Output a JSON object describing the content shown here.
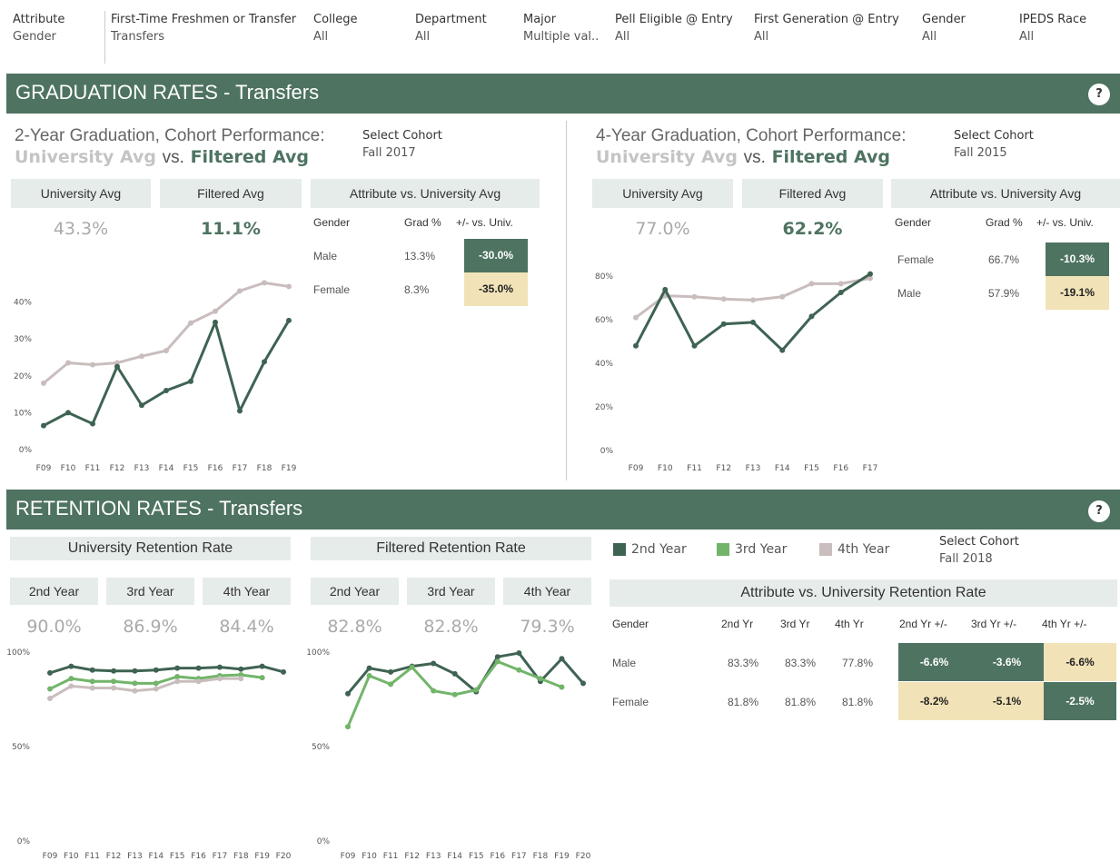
{
  "filters": [
    {
      "label": "Attribute",
      "value": "Gender"
    },
    {
      "label": "First-Time Freshmen or Transfer",
      "value": "Transfers"
    },
    {
      "label": "College",
      "value": "All"
    },
    {
      "label": "Department",
      "value": "All"
    },
    {
      "label": "Major",
      "value": "Multiple val.."
    },
    {
      "label": "Pell Eligible @ Entry",
      "value": "All"
    },
    {
      "label": "First Generation @ Entry",
      "value": "All"
    },
    {
      "label": "Gender",
      "value": "All"
    },
    {
      "label": "IPEDS Race",
      "value": "All"
    }
  ],
  "colors": {
    "accent": "#4e7361",
    "university_line": "#c9bdbd",
    "filtered_line": "#3f6353",
    "third_year": "#72b56a",
    "highlight": "#f1e3b7"
  },
  "graduation": {
    "banner_title": "GRADUATION RATES - Transfers",
    "help_icon": "?",
    "left": {
      "title": "2-Year Graduation, Cohort Performance:",
      "sub_uni": "University Avg",
      "sub_vs": "vs.",
      "sub_filtered": "Filtered Avg",
      "select_cohort_label": "Select Cohort",
      "select_cohort_value": "Fall 2017",
      "uni_header": "University Avg",
      "filtered_header": "Filtered Avg",
      "uni_value": "43.3%",
      "filtered_value": "11.1%",
      "attr_header": "Attribute vs. University Avg",
      "col_attr": "Gender",
      "col_grad": "Grad %",
      "col_diff": "+/- vs. Univ.",
      "rows": [
        {
          "attr": "Male",
          "grad": "13.3%",
          "diff": "-30.0%",
          "tone": "dark"
        },
        {
          "attr": "Female",
          "grad": "8.3%",
          "diff": "-35.0%",
          "tone": "light"
        }
      ]
    },
    "right": {
      "title": "4-Year Graduation, Cohort Performance:",
      "sub_uni": "University Avg",
      "sub_vs": "vs.",
      "sub_filtered": "Filtered Avg",
      "select_cohort_label": "Select Cohort",
      "select_cohort_value": "Fall 2015",
      "uni_header": "University Avg",
      "filtered_header": "Filtered Avg",
      "uni_value": "77.0%",
      "filtered_value": "62.2%",
      "attr_header": "Attribute vs. University Avg",
      "col_attr": "Gender",
      "col_grad": "Grad %",
      "col_diff": "+/- vs. Univ.",
      "rows": [
        {
          "attr": "Female",
          "grad": "66.7%",
          "diff": "-10.3%",
          "tone": "dark"
        },
        {
          "attr": "Male",
          "grad": "57.9%",
          "diff": "-19.1%",
          "tone": "light"
        }
      ]
    }
  },
  "retention": {
    "banner_title": "RETENTION RATES - Transfers",
    "help_icon": "?",
    "uni_title": "University Retention Rate",
    "filtered_title": "Filtered Retention Rate",
    "year_headers": [
      "2nd Year",
      "3rd Year",
      "4th Year"
    ],
    "uni_values": [
      "90.0%",
      "86.9%",
      "84.4%"
    ],
    "filtered_values": [
      "82.8%",
      "82.8%",
      "79.3%"
    ],
    "legend": [
      {
        "label": "2nd Year",
        "color": "#3f6353"
      },
      {
        "label": "3rd Year",
        "color": "#72b56a"
      },
      {
        "label": "4th Year",
        "color": "#c9bdbd"
      }
    ],
    "select_cohort_label": "Select Cohort",
    "select_cohort_value": "Fall 2018",
    "attr_header": "Attribute vs. University Retention Rate",
    "cols": [
      "Gender",
      "2nd Yr",
      "3rd Yr",
      "4th Yr",
      "2nd Yr +/-",
      "3rd Yr +/-",
      "4th Yr +/-"
    ],
    "rows": [
      {
        "attr": "Male",
        "y2": "83.3%",
        "y3": "83.3%",
        "y4": "77.8%",
        "d2": "-6.6%",
        "d3": "-3.6%",
        "d4": "-6.6%",
        "t2": "dark",
        "t3": "dark",
        "t4": "light"
      },
      {
        "attr": "Female",
        "y2": "81.8%",
        "y3": "81.8%",
        "y4": "81.8%",
        "d2": "-8.2%",
        "d3": "-5.1%",
        "d4": "-2.5%",
        "t2": "light",
        "t3": "light",
        "t4": "dark"
      }
    ]
  },
  "chart_data": [
    {
      "type": "line",
      "title": "2-Year Graduation, Cohort Performance",
      "categories": [
        "F09",
        "F10",
        "F11",
        "F12",
        "F13",
        "F14",
        "F15",
        "F16",
        "F17",
        "F18",
        "F19"
      ],
      "yticks": [
        "0%",
        "10%",
        "20%",
        "30%",
        "40%"
      ],
      "ylim": [
        0,
        48
      ],
      "series": [
        {
          "name": "University Avg",
          "values": [
            18,
            23.5,
            23,
            23.5,
            25.3,
            26.8,
            34.3,
            37.5,
            43,
            45.2,
            44.2
          ]
        },
        {
          "name": "Filtered Avg",
          "values": [
            6.5,
            10,
            7,
            22.5,
            12,
            16,
            18.5,
            34.5,
            10.5,
            23.8,
            35
          ]
        }
      ]
    },
    {
      "type": "line",
      "title": "4-Year Graduation, Cohort Performance",
      "categories": [
        "F09",
        "F10",
        "F11",
        "F12",
        "F13",
        "F14",
        "F15",
        "F16",
        "F17"
      ],
      "yticks": [
        "0%",
        "20%",
        "40%",
        "60%",
        "80%"
      ],
      "ylim": [
        0,
        90
      ],
      "series": [
        {
          "name": "University Avg",
          "values": [
            61,
            71,
            70.5,
            69.5,
            69,
            70.5,
            76.5,
            76.5,
            79
          ]
        },
        {
          "name": "Filtered Avg",
          "values": [
            48,
            73.8,
            48,
            58,
            58.8,
            46,
            61.5,
            72.5,
            81
          ]
        }
      ]
    },
    {
      "type": "line",
      "title": "University Retention Rate",
      "categories": [
        "F09",
        "F10",
        "F11",
        "F12",
        "F13",
        "F14",
        "F15",
        "F16",
        "F17",
        "F18",
        "F19",
        "F20"
      ],
      "yticks": [
        "0%",
        "50%",
        "100%"
      ],
      "ylim": [
        0,
        100
      ],
      "series": [
        {
          "name": "2nd Year",
          "values": [
            89,
            92.5,
            90.5,
            90,
            90,
            90.5,
            91.5,
            91.5,
            92,
            91,
            92.5,
            89.5
          ]
        },
        {
          "name": "3rd Year",
          "values": [
            80.5,
            86,
            84.5,
            84.5,
            83.5,
            83.5,
            87,
            86,
            87.5,
            88,
            86.5,
            null
          ]
        },
        {
          "name": "4th Year",
          "values": [
            75.5,
            82,
            81,
            81,
            79.5,
            80.5,
            84.5,
            84.5,
            86,
            86,
            null,
            null
          ]
        }
      ]
    },
    {
      "type": "line",
      "title": "Filtered Retention Rate",
      "categories": [
        "F09",
        "F10",
        "F11",
        "F12",
        "F13",
        "F14",
        "F15",
        "F16",
        "F17",
        "F18",
        "F19",
        "F20"
      ],
      "yticks": [
        "0%",
        "50%",
        "100%"
      ],
      "ylim": [
        0,
        100
      ],
      "series": [
        {
          "name": "2nd Year",
          "values": [
            78,
            91.5,
            89.5,
            92.5,
            94,
            88.5,
            79,
            97.5,
            99.5,
            84.5,
            96.5,
            83.5
          ]
        },
        {
          "name": "3rd Year",
          "values": [
            60.5,
            87.5,
            83,
            92,
            79.5,
            77.5,
            80,
            95,
            90.5,
            86,
            81.5,
            null
          ]
        },
        {
          "name": "4th Year",
          "values": null
        }
      ]
    }
  ]
}
